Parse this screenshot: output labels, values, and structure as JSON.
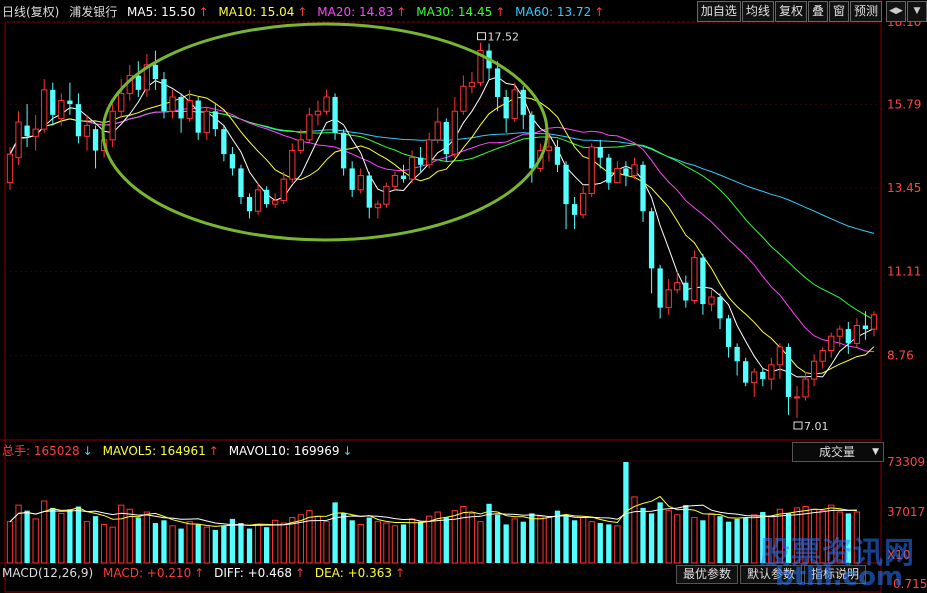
{
  "header": {
    "name": "日线(复权)",
    "stock": "浦发银行",
    "ma5": "MA5: 15.50",
    "ma10": "MA10: 15.04",
    "ma20": "MA20: 14.83",
    "ma30": "MA30: 14.45",
    "ma60": "MA60: 13.72"
  },
  "toolbar": {
    "items": [
      "加自选",
      "均线",
      "复权",
      "叠",
      "窗",
      "预测"
    ],
    "icons": [
      "◀▶",
      "▼"
    ]
  },
  "volume_header": {
    "zongshou": "总手: 165028",
    "mavol5": "MAVOL5: 164961",
    "mavol10": "MAVOL10: 169969",
    "selector": "成交量"
  },
  "macd_header": {
    "name": "MACD(12,26,9)",
    "macd": "MACD: +0.210",
    "diff": "DIFF: +0.468",
    "dea": "DEA: +0.363"
  },
  "buttons": [
    "最优参数",
    "默认参数",
    "指标说明"
  ],
  "price_ticks": [
    "18.10",
    "15.79",
    "13.45",
    "11.11",
    "8.76"
  ],
  "volume_ticks": [
    "73309",
    "37017",
    "X10"
  ],
  "macd_tick": "0.715",
  "watermark": {
    "line1": "股票资讯网",
    "line2": "btlll.com"
  },
  "colors": {
    "up": "#ff3333",
    "down": "#54ffff",
    "ma5": "#ffffff",
    "ma10": "#ffff33",
    "ma20": "#ff44ff",
    "ma30": "#33ff33",
    "ma60": "#33ccff",
    "ellipse": "#7dbf33"
  },
  "chart_data": {
    "type": "candlestick",
    "title": "浦发银行 日线(复权)",
    "ylim": [
      7.01,
      18.1
    ],
    "annotations": [
      {
        "label": "17.52",
        "value": 17.52
      },
      {
        "label": "7.01",
        "value": 7.01
      }
    ],
    "candles": [
      [
        13.6,
        14.4,
        14.6,
        13.4
      ],
      [
        14.3,
        15.3,
        15.6,
        14.1
      ],
      [
        15.2,
        14.9,
        15.8,
        14.6
      ],
      [
        14.9,
        15.1,
        15.5,
        14.5
      ],
      [
        15.1,
        16.2,
        16.5,
        15.0
      ],
      [
        16.2,
        15.5,
        16.4,
        15.2
      ],
      [
        15.4,
        15.9,
        16.1,
        15.2
      ],
      [
        15.9,
        15.8,
        16.4,
        15.5
      ],
      [
        15.8,
        14.9,
        16.1,
        14.7
      ],
      [
        14.9,
        15.2,
        15.5,
        14.5
      ],
      [
        15.1,
        14.5,
        15.2,
        14.0
      ],
      [
        14.5,
        14.8,
        15.0,
        14.3
      ],
      [
        14.8,
        15.6,
        15.8,
        14.6
      ],
      [
        15.6,
        16.1,
        16.5,
        15.4
      ],
      [
        16.1,
        16.6,
        16.9,
        15.9
      ],
      [
        16.6,
        16.2,
        17.0,
        16.0
      ],
      [
        16.2,
        16.9,
        17.2,
        16.0
      ],
      [
        16.9,
        16.5,
        17.3,
        16.2
      ],
      [
        16.5,
        15.6,
        16.7,
        15.4
      ],
      [
        15.6,
        16.0,
        16.2,
        15.4
      ],
      [
        16.0,
        15.4,
        16.1,
        15.0
      ],
      [
        15.4,
        15.9,
        16.2,
        15.3
      ],
      [
        15.9,
        15.0,
        16.0,
        14.8
      ],
      [
        15.0,
        15.6,
        15.7,
        14.8
      ],
      [
        15.6,
        15.1,
        15.8,
        14.9
      ],
      [
        15.1,
        14.4,
        15.2,
        14.2
      ],
      [
        14.4,
        14.0,
        14.6,
        13.8
      ],
      [
        14.0,
        13.2,
        14.1,
        13.0
      ],
      [
        13.2,
        12.8,
        13.3,
        12.6
      ],
      [
        12.8,
        13.4,
        13.6,
        12.7
      ],
      [
        13.4,
        13.0,
        13.5,
        12.9
      ],
      [
        13.0,
        13.1,
        13.3,
        12.9
      ],
      [
        13.1,
        13.7,
        13.9,
        13.0
      ],
      [
        13.7,
        14.5,
        14.7,
        13.6
      ],
      [
        14.5,
        14.8,
        15.1,
        14.4
      ],
      [
        14.8,
        15.5,
        15.7,
        14.7
      ],
      [
        15.5,
        15.6,
        15.9,
        15.2
      ],
      [
        15.6,
        16.0,
        16.2,
        15.5
      ],
      [
        16.0,
        15.0,
        16.1,
        14.8
      ],
      [
        15.0,
        14.0,
        15.1,
        13.8
      ],
      [
        14.0,
        13.4,
        14.2,
        13.2
      ],
      [
        13.4,
        13.8,
        14.0,
        13.3
      ],
      [
        13.8,
        12.9,
        13.9,
        12.6
      ],
      [
        12.9,
        13.0,
        13.1,
        12.6
      ],
      [
        13.0,
        13.5,
        13.6,
        12.9
      ],
      [
        13.5,
        13.8,
        13.9,
        13.4
      ],
      [
        13.8,
        13.7,
        14.1,
        13.6
      ],
      [
        13.7,
        14.3,
        14.5,
        13.6
      ],
      [
        14.3,
        14.1,
        14.6,
        13.9
      ],
      [
        14.1,
        14.8,
        15.0,
        14.0
      ],
      [
        14.8,
        15.3,
        15.7,
        14.7
      ],
      [
        15.3,
        14.4,
        15.4,
        14.2
      ],
      [
        14.4,
        15.6,
        16.0,
        14.3
      ],
      [
        15.6,
        16.3,
        16.6,
        15.5
      ],
      [
        16.3,
        16.4,
        16.7,
        16.1
      ],
      [
        16.4,
        17.3,
        17.52,
        16.3
      ],
      [
        17.3,
        16.8,
        17.5,
        16.5
      ],
      [
        16.8,
        16.0,
        17.0,
        15.6
      ],
      [
        16.0,
        15.4,
        16.2,
        15.0
      ],
      [
        15.4,
        16.2,
        16.4,
        15.3
      ],
      [
        16.2,
        15.5,
        16.3,
        15.1
      ],
      [
        15.5,
        14.0,
        15.6,
        13.6
      ],
      [
        14.0,
        14.5,
        14.7,
        13.9
      ],
      [
        14.5,
        14.6,
        15.0,
        14.2
      ],
      [
        14.6,
        14.1,
        14.8,
        13.9
      ],
      [
        14.1,
        13.0,
        14.2,
        12.3
      ],
      [
        13.0,
        12.7,
        13.2,
        12.3
      ],
      [
        12.7,
        13.3,
        13.5,
        12.6
      ],
      [
        13.3,
        14.6,
        14.7,
        13.2
      ],
      [
        14.6,
        14.3,
        14.8,
        14.0
      ],
      [
        14.3,
        13.6,
        14.4,
        13.4
      ],
      [
        13.6,
        14.0,
        14.2,
        13.6
      ],
      [
        14.0,
        13.8,
        14.2,
        13.5
      ],
      [
        13.8,
        14.1,
        14.3,
        13.7
      ],
      [
        14.1,
        12.8,
        14.2,
        12.5
      ],
      [
        12.8,
        11.2,
        12.9,
        10.5
      ],
      [
        11.2,
        10.1,
        11.3,
        9.8
      ],
      [
        10.1,
        10.6,
        10.9,
        9.9
      ],
      [
        10.6,
        10.8,
        11.1,
        10.5
      ],
      [
        10.8,
        10.3,
        11.0,
        10.1
      ],
      [
        10.3,
        11.5,
        11.7,
        10.2
      ],
      [
        11.5,
        10.2,
        11.6,
        9.9
      ],
      [
        10.2,
        10.4,
        10.6,
        10.0
      ],
      [
        10.4,
        9.8,
        10.5,
        9.5
      ],
      [
        9.8,
        9.0,
        9.9,
        8.7
      ],
      [
        9.0,
        8.6,
        9.1,
        8.2
      ],
      [
        8.6,
        8.0,
        8.7,
        7.9
      ],
      [
        8.0,
        8.3,
        8.4,
        7.6
      ],
      [
        8.3,
        8.1,
        8.4,
        7.9
      ],
      [
        8.1,
        8.5,
        8.7,
        7.8
      ],
      [
        8.5,
        9.0,
        9.1,
        8.1
      ],
      [
        9.0,
        7.6,
        9.1,
        7.1
      ],
      [
        7.6,
        7.6,
        7.9,
        7.01
      ],
      [
        7.6,
        8.1,
        8.3,
        7.5
      ],
      [
        8.1,
        8.6,
        8.8,
        7.9
      ],
      [
        8.6,
        8.9,
        9.0,
        8.4
      ],
      [
        8.9,
        9.3,
        9.4,
        8.7
      ],
      [
        9.3,
        9.5,
        9.6,
        9.0
      ],
      [
        9.5,
        9.1,
        9.7,
        8.8
      ],
      [
        9.1,
        9.6,
        9.8,
        9.0
      ],
      [
        9.6,
        9.5,
        10.0,
        9.2
      ],
      [
        9.5,
        9.9,
        10.0,
        9.3
      ]
    ],
    "volumes": [
      30000,
      42000,
      38000,
      32000,
      45000,
      40000,
      36000,
      39000,
      41000,
      30000,
      34000,
      28000,
      26000,
      42000,
      39000,
      33000,
      37000,
      29000,
      31000,
      27000,
      25000,
      30000,
      28000,
      26000,
      24000,
      27000,
      32000,
      29000,
      25000,
      28000,
      26000,
      31000,
      29000,
      33000,
      35000,
      38000,
      34000,
      30000,
      44000,
      36000,
      31000,
      28000,
      33000,
      30000,
      29000,
      27000,
      28000,
      32000,
      30000,
      34000,
      37000,
      33000,
      38000,
      41000,
      36000,
      30000,
      43000,
      35000,
      28000,
      32000,
      30000,
      36000,
      34000,
      33000,
      38000,
      35000,
      31000,
      33000,
      30000,
      29000,
      28000,
      27000,
      73309,
      48000,
      40000,
      36000,
      44000,
      38000,
      35000,
      42000,
      33000,
      31000,
      36000,
      34000,
      30000,
      32000,
      33000,
      35000,
      37000,
      34000,
      39000,
      36000,
      40000,
      41000,
      39000,
      38000,
      42000,
      37000,
      36000,
      37017
    ]
  }
}
